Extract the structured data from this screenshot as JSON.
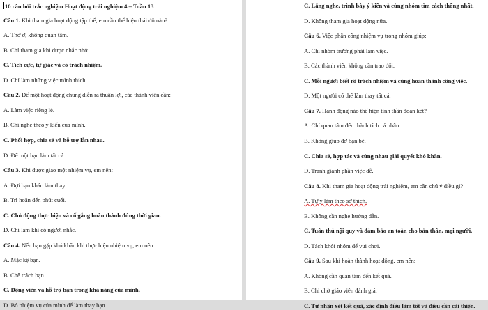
{
  "left": {
    "title": "10 câu hỏi trắc nghiệm Hoạt động trải nghiệm 4 – Tuần 13",
    "lines": [
      {
        "label": "Câu 1.",
        "text": " Khi tham gia hoạt động tập thể, em cần thể hiện thái độ nào?"
      },
      {
        "text": "A. Thờ ơ, không quan tâm."
      },
      {
        "text": "B. Chỉ tham gia khi được nhắc nhở."
      },
      {
        "text": "C. Tích cực, tự giác và có trách nhiệm.",
        "bold": true
      },
      {
        "text": "D. Chỉ làm những việc mình thích."
      },
      {
        "label": "Câu 2.",
        "text": " Để một hoạt động chung diễn ra thuận lợi, các thành viên cần:"
      },
      {
        "text": "A. Làm việc riêng lẻ."
      },
      {
        "text": "B. Chỉ nghe theo ý kiến của mình."
      },
      {
        "text": "C. Phối hợp, chia sẻ và hỗ trợ lẫn nhau.",
        "bold": true
      },
      {
        "text": "D. Để một bạn làm tất cả."
      },
      {
        "label": "Câu 3.",
        "text": " Khi được giao một nhiệm vụ, em nên:"
      },
      {
        "text": "A. Đợi bạn khác làm thay."
      },
      {
        "text": "B. Trì hoãn đến phút cuối."
      },
      {
        "text": "C. Chủ động thực hiện và cố gắng hoàn thành đúng thời gian.",
        "bold": true
      },
      {
        "text": "D. Chỉ làm khi có người nhắc."
      },
      {
        "label": "Câu 4.",
        "text": " Nếu bạn gặp khó khăn khi thực hiện nhiệm vụ, em nên:"
      },
      {
        "text": "A. Mặc kệ bạn."
      },
      {
        "text": "B. Chê trách bạn."
      },
      {
        "text": "C. Động viên và hỗ trợ bạn trong khả năng của mình.",
        "bold": true
      },
      {
        "text": "D. Bỏ nhiệm vụ của mình để làm thay bạn."
      }
    ]
  },
  "right": {
    "lines": [
      {
        "text": "C. Lắng nghe, trình bày ý kiến và cùng nhóm tìm cách thống nhất.",
        "bold": true
      },
      {
        "text": "D. Không tham gia hoạt động nữa."
      },
      {
        "label": "Câu 6.",
        "text": " Việc phân công nhiệm vụ trong nhóm giúp:"
      },
      {
        "text": "A. Chỉ nhóm trưởng phải làm việc."
      },
      {
        "text": "B. Các thành viên không cần trao đổi."
      },
      {
        "text": "C. Mỗi người biết rõ trách nhiệm và cùng hoàn thành công việc.",
        "bold": true
      },
      {
        "text": "D. Một người có thể làm thay tất cả."
      },
      {
        "label": "Câu 7.",
        "text": " Hành động nào thể hiện tinh thần đoàn kết?"
      },
      {
        "text": "A. Chỉ quan tâm đến thành tích cá nhân."
      },
      {
        "text": "B. Không giúp đỡ bạn bè."
      },
      {
        "text": "C. Chia sẻ, hợp tác và cùng nhau giải quyết khó khăn.",
        "bold": true
      },
      {
        "text": "D. Tranh giành phần việc dễ."
      },
      {
        "label": "Câu 8.",
        "text": " Khi tham gia hoạt động trải nghiệm, em cần chú ý điều gì?"
      },
      {
        "text": "A. Tự ý làm theo sở thích.",
        "misspelled": true
      },
      {
        "text": "B. Không cần nghe hướng dẫn."
      },
      {
        "text": "C. Tuân thủ nội quy và đảm bảo an toàn cho bản thân, mọi người.",
        "bold": true
      },
      {
        "text": "D. Tách khỏi nhóm để vui chơi."
      },
      {
        "label": "Câu 9.",
        "text": " Sau khi hoàn thành hoạt động, em nên:"
      },
      {
        "text": "A. Không cần quan tâm đến kết quả."
      },
      {
        "text": "B. Chỉ chờ giáo viên đánh giá."
      },
      {
        "text": "C. Tự nhận xét kết quả, xác định điều làm tốt và điều cần cải thiện.",
        "bold": true
      }
    ]
  }
}
